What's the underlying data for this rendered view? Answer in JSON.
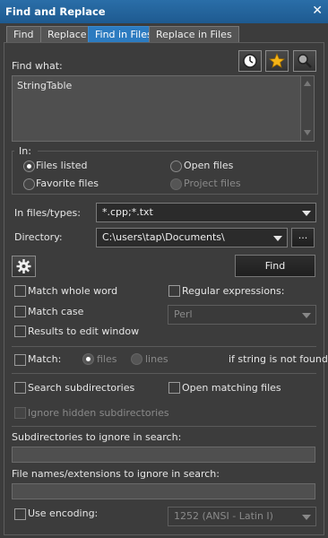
{
  "window": {
    "title": "Find and Replace"
  },
  "tabs": [
    {
      "label": "Find"
    },
    {
      "label": "Replace"
    },
    {
      "label": "Find in Files",
      "active": true
    },
    {
      "label": "Replace in Files"
    }
  ],
  "find_what": {
    "label": "Find what:",
    "value": "StringTable"
  },
  "toolbar_icons": [
    "clock-icon",
    "star-icon",
    "magnifier-icon"
  ],
  "in_group": {
    "label": "In:",
    "options": [
      {
        "label": "Files listed",
        "selected": true
      },
      {
        "label": "Open files"
      },
      {
        "label": "Favorite files"
      },
      {
        "label": "Project files",
        "disabled": true
      }
    ]
  },
  "file_types": {
    "label": "In files/types:",
    "value": "*.cpp;*.txt"
  },
  "directory": {
    "label": "Directory:",
    "value": "C:\\users\\tap\\Documents\\",
    "browse_label": "..."
  },
  "find_button": "Find",
  "options": {
    "match_whole_word": "Match whole word",
    "match_case": "Match case",
    "results_to_edit": "Results to edit window",
    "regex": "Regular expressions:",
    "regex_type": "Perl"
  },
  "match_row": {
    "label": "Match:",
    "files": "files",
    "lines": "lines",
    "suffix": "if string is not found"
  },
  "search_subdirs": "Search subdirectories",
  "open_matching": "Open matching files",
  "ignore_hidden": "Ignore hidden subdirectories",
  "subdirs_ignore_label": "Subdirectories to ignore in search:",
  "file_ext_ignore_label": "File names/extensions to ignore in search:",
  "encoding": {
    "label": "Use encoding:",
    "value": "1252  (ANSI - Latin I)"
  },
  "colors": {
    "title_bar": "#1e5a90",
    "active_tab": "#2c7bc0",
    "background": "#3c3c3c"
  }
}
